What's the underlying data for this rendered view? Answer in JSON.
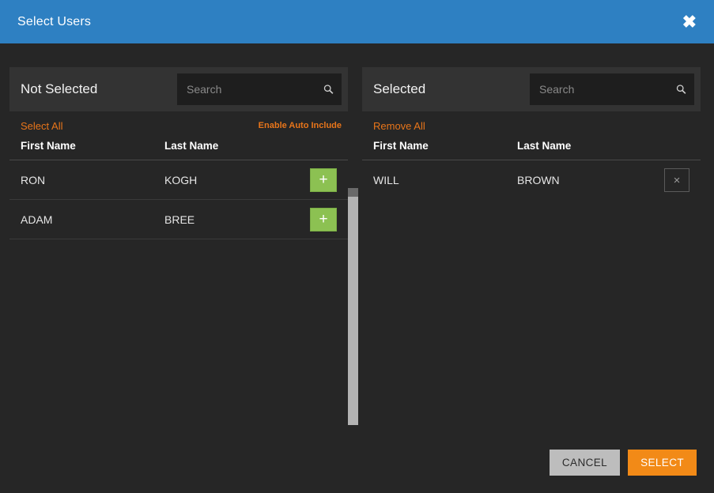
{
  "dialog": {
    "title": "Select Users",
    "close_icon": "close-icon",
    "accent_blue": "#2e80c2",
    "accent_orange": "#e8751a",
    "accent_green": "#8cc152",
    "background": "#262626"
  },
  "panels": [
    {
      "key": "not_selected",
      "title": "Not Selected",
      "search": {
        "value": "",
        "placeholder": "Search",
        "icon": "search-icon"
      },
      "primary_link": "Select All",
      "secondary_link": "Enable Auto Include",
      "columns": {
        "first": "First Name",
        "last": "Last Name"
      },
      "rows": [
        {
          "first": "RON",
          "last": "KOGH",
          "action": "+"
        },
        {
          "first": "ADAM",
          "last": "BREE",
          "action": "+"
        }
      ]
    },
    {
      "key": "selected",
      "title": "Selected",
      "search": {
        "value": "",
        "placeholder": "Search",
        "icon": "search-icon"
      },
      "primary_link": "Remove All",
      "secondary_link": "",
      "columns": {
        "first": "First Name",
        "last": "Last Name"
      },
      "rows": [
        {
          "first": "WILL",
          "last": "BROWN",
          "action": "×"
        }
      ]
    }
  ],
  "footer": {
    "cancel_label": "CANCEL",
    "select_label": "SELECT"
  }
}
